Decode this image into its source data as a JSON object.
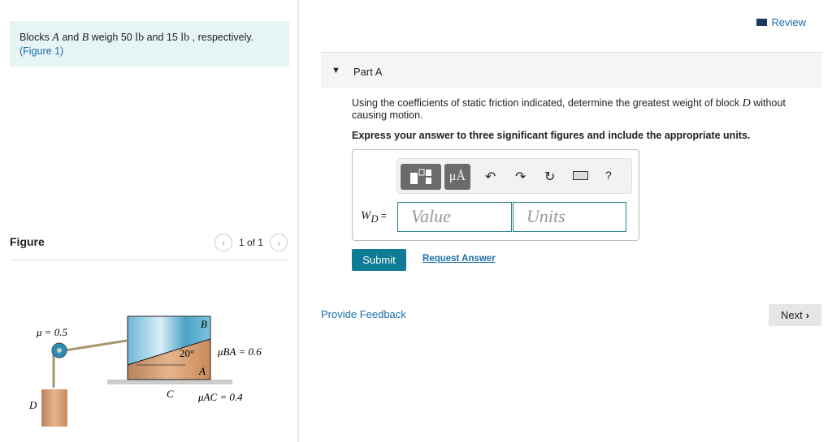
{
  "problem": {
    "pre": "Blocks ",
    "A": "A",
    "mid1": " and ",
    "B": "B",
    "mid2": " weigh 50 ",
    "u1": "lb",
    "mid3": " and 15 ",
    "u2": "lb",
    "post": " , respectively.",
    "figure_link": "(Figure 1)"
  },
  "figure": {
    "title": "Figure",
    "pager": "1 of 1",
    "labels": {
      "mu_pulley": "μ = 0.5",
      "B": "B",
      "A": "A",
      "C": "C",
      "D": "D",
      "angle": "20°",
      "mu_ba": "μBA = 0.6",
      "mu_ac": "μAC = 0.4"
    }
  },
  "review": "Review",
  "part": {
    "label": "Part A",
    "question_pre": "Using the coefficients of static friction indicated, determine the greatest weight of block ",
    "question_var": "D",
    "question_post": " without causing motion.",
    "instruction": "Express your answer to three significant figures and include the appropriate units."
  },
  "answer": {
    "label": "W",
    "sub": "D",
    "eq": " =",
    "value_placeholder": "Value",
    "units_placeholder": "Units",
    "toolbar": {
      "units_btn": "μÅ",
      "help": "?",
      "icons": [
        "templates-icon",
        "units-icon",
        "undo-icon",
        "redo-icon",
        "reset-icon",
        "keyboard-icon",
        "help-icon"
      ]
    }
  },
  "buttons": {
    "submit": "Submit",
    "request": "Request Answer",
    "feedback": "Provide Feedback",
    "next": "Next"
  },
  "colors": {
    "accent": "#0e7c94",
    "link": "#1a6fa8",
    "problem_bg": "#e6f4f6"
  }
}
